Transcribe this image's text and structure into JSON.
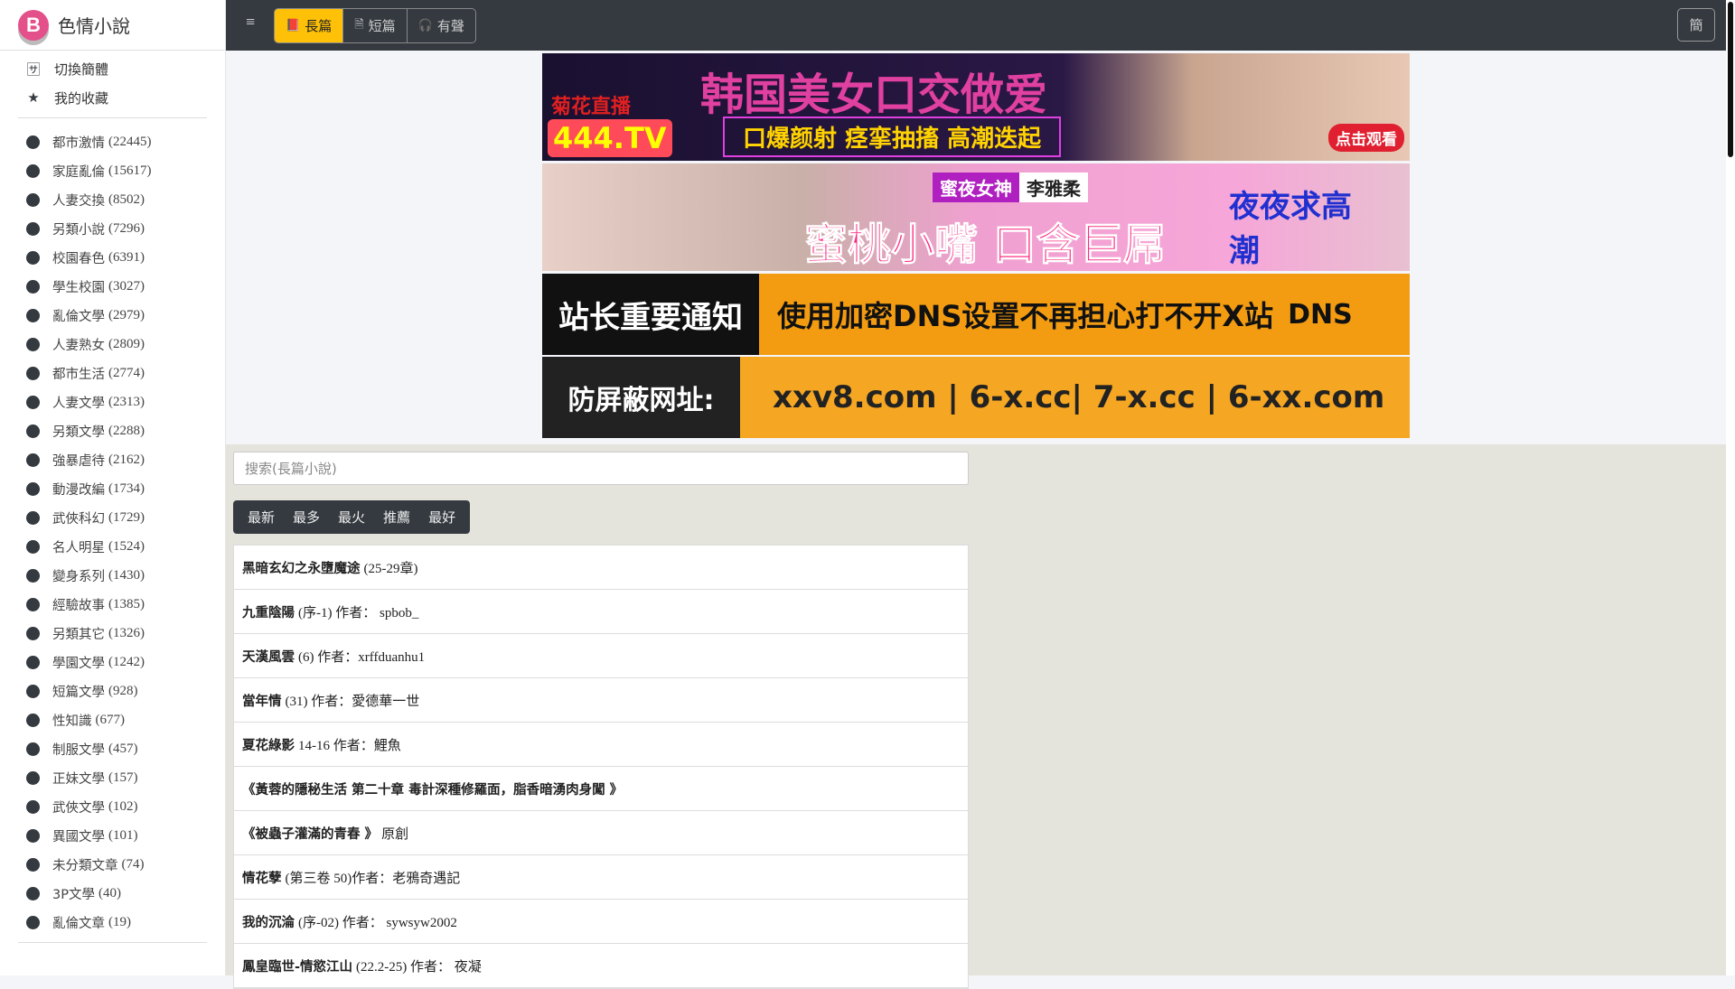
{
  "brand": {
    "logo_letter": "B",
    "name": "色情小說"
  },
  "sidebar": {
    "links": [
      {
        "icon": "translate-icon",
        "label": "切換簡體"
      },
      {
        "icon": "star-icon",
        "label": "我的收藏"
      }
    ],
    "categories": [
      {
        "name": "都市激情",
        "count": "(22445)"
      },
      {
        "name": "家庭亂倫",
        "count": "(15617)"
      },
      {
        "name": "人妻交換",
        "count": "(8502)"
      },
      {
        "name": "另類小說",
        "count": "(7296)"
      },
      {
        "name": "校園春色",
        "count": "(6391)"
      },
      {
        "name": "學生校園",
        "count": "(3027)"
      },
      {
        "name": "亂倫文學",
        "count": "(2979)"
      },
      {
        "name": "人妻熟女",
        "count": "(2809)"
      },
      {
        "name": "都市生活",
        "count": "(2774)"
      },
      {
        "name": "人妻文學",
        "count": "(2313)"
      },
      {
        "name": "另類文學",
        "count": "(2288)"
      },
      {
        "name": "強暴虐待",
        "count": "(2162)"
      },
      {
        "name": "動漫改編",
        "count": "(1734)"
      },
      {
        "name": "武俠科幻",
        "count": "(1729)"
      },
      {
        "name": "名人明星",
        "count": "(1524)"
      },
      {
        "name": "變身系列",
        "count": "(1430)"
      },
      {
        "name": "經驗故事",
        "count": "(1385)"
      },
      {
        "name": "另類其它",
        "count": "(1326)"
      },
      {
        "name": "學園文學",
        "count": "(1242)"
      },
      {
        "name": "短篇文學",
        "count": "(928)"
      },
      {
        "name": "性知識",
        "count": "(677)"
      },
      {
        "name": "制服文學",
        "count": "(457)"
      },
      {
        "name": "正妹文學",
        "count": "(157)"
      },
      {
        "name": "武俠文學",
        "count": "(102)"
      },
      {
        "name": "異國文學",
        "count": "(101)"
      },
      {
        "name": "未分類文章",
        "count": "(74)"
      },
      {
        "name": "3P文學",
        "count": "(40)"
      },
      {
        "name": "亂倫文章",
        "count": "(19)"
      }
    ]
  },
  "topbar": {
    "menu_icon": "≡",
    "segments": [
      {
        "icon": "book-icon",
        "label": "長篇",
        "active": true
      },
      {
        "icon": "file-icon",
        "label": "短篇",
        "active": false
      },
      {
        "icon": "headphones-icon",
        "label": "有聲",
        "active": false
      }
    ],
    "simplified_label": "簡"
  },
  "banners": {
    "b1": {
      "brand": "菊花直播",
      "site": "444.TV",
      "headline": "韩国美女口交做爱",
      "sub": "口爆颜射 痉挛抽搐 高潮迭起",
      "cta": "点击观看"
    },
    "b2": {
      "tag1": "蜜夜女神",
      "tag2": "李雅柔",
      "headline": "蜜桃小嘴 口含巨屌",
      "side": "夜夜求高潮"
    },
    "b3": {
      "left": "站长重要通知",
      "right": "使用加密DNS设置不再担心打不开X站",
      "dns": "DNS"
    },
    "b4": {
      "left": "防屏蔽网址:",
      "right": "xxv8.com | 6-x.cc| 7-x.cc | 6-xx.com"
    }
  },
  "search": {
    "placeholder": "搜索(長篇小說)"
  },
  "sort_tabs": [
    "最新",
    "最多",
    "最火",
    "推薦",
    "最好"
  ],
  "stories": [
    {
      "title": "黑暗玄幻之永墮魔途",
      "meta": "(25-29章)"
    },
    {
      "title": "九重陰陽",
      "meta": "(序-1) 作者： spbob_"
    },
    {
      "title": "天漢風雲",
      "meta": "(6) 作者：xrffduanhu1"
    },
    {
      "title": "當年情",
      "meta": "(31) 作者：愛德華一世"
    },
    {
      "title": "夏花綠影",
      "meta": "14-16 作者：鯉魚"
    },
    {
      "title": "《黃蓉的隱秘生活 第二十章 毒計深種修羅面，脂香暗湧肉身闖 》",
      "meta": ""
    },
    {
      "title": "《被蟲子灌滿的青春 》",
      "meta": "原創"
    },
    {
      "title": "情花孽",
      "meta": "(第三卷 50)作者：老鴉奇遇記"
    },
    {
      "title": "我的沉淪",
      "meta": "(序-02) 作者： sywsyw2002"
    },
    {
      "title": "鳳皇臨世-情慾江山",
      "meta": "(22.2-25) 作者： 夜凝"
    }
  ]
}
